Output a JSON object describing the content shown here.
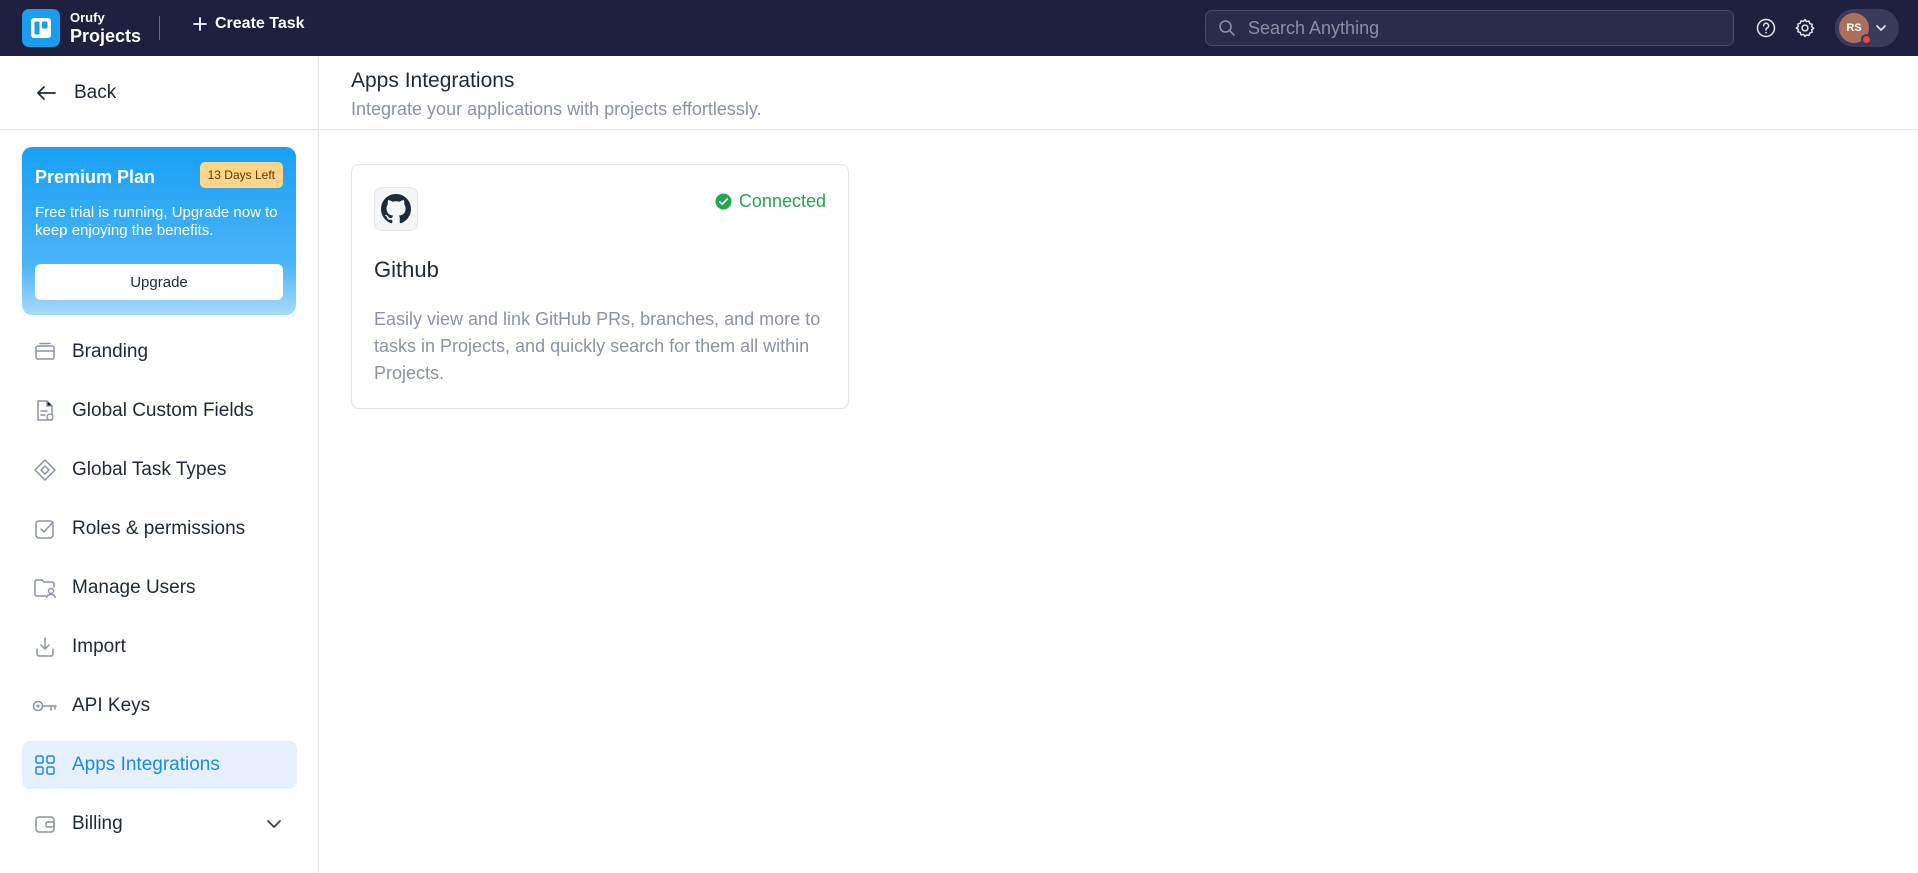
{
  "topbar": {
    "brand_small": "Orufy",
    "brand_big": "Projects",
    "create_task_label": "Create Task",
    "search_placeholder": "Search Anything",
    "avatar_initials": "RS"
  },
  "sidebar": {
    "back_label": "Back",
    "premium": {
      "title": "Premium Plan",
      "badge": "13 Days Left",
      "description": "Free trial is running, Upgrade now to keep enjoying the benefits.",
      "upgrade_label": "Upgrade"
    },
    "items": [
      {
        "label": "Branding",
        "icon": "branding-icon"
      },
      {
        "label": "Global Custom Fields",
        "icon": "custom-fields-icon"
      },
      {
        "label": "Global Task Types",
        "icon": "task-types-icon"
      },
      {
        "label": "Roles & permissions",
        "icon": "roles-icon"
      },
      {
        "label": "Manage Users",
        "icon": "users-folder-icon"
      },
      {
        "label": "Import",
        "icon": "import-icon"
      },
      {
        "label": "API Keys",
        "icon": "key-icon"
      },
      {
        "label": "Apps Integrations",
        "icon": "apps-grid-icon",
        "active": true
      },
      {
        "label": "Billing",
        "icon": "wallet-icon",
        "has_chevron": true
      }
    ]
  },
  "main": {
    "title": "Apps Integrations",
    "subtitle": "Integrate your applications with projects effortlessly.",
    "integrations": [
      {
        "name": "Github",
        "status": "Connected",
        "description": "Easily view and link GitHub PRs, branches, and more to tasks in Projects, and quickly search for them all within Projects."
      }
    ]
  },
  "colors": {
    "topbar_bg": "#1f1f3f",
    "accent": "#1a9cf0",
    "active_bg": "#e7f1fd",
    "active_text": "#1e88e5",
    "connected": "#22a652"
  }
}
